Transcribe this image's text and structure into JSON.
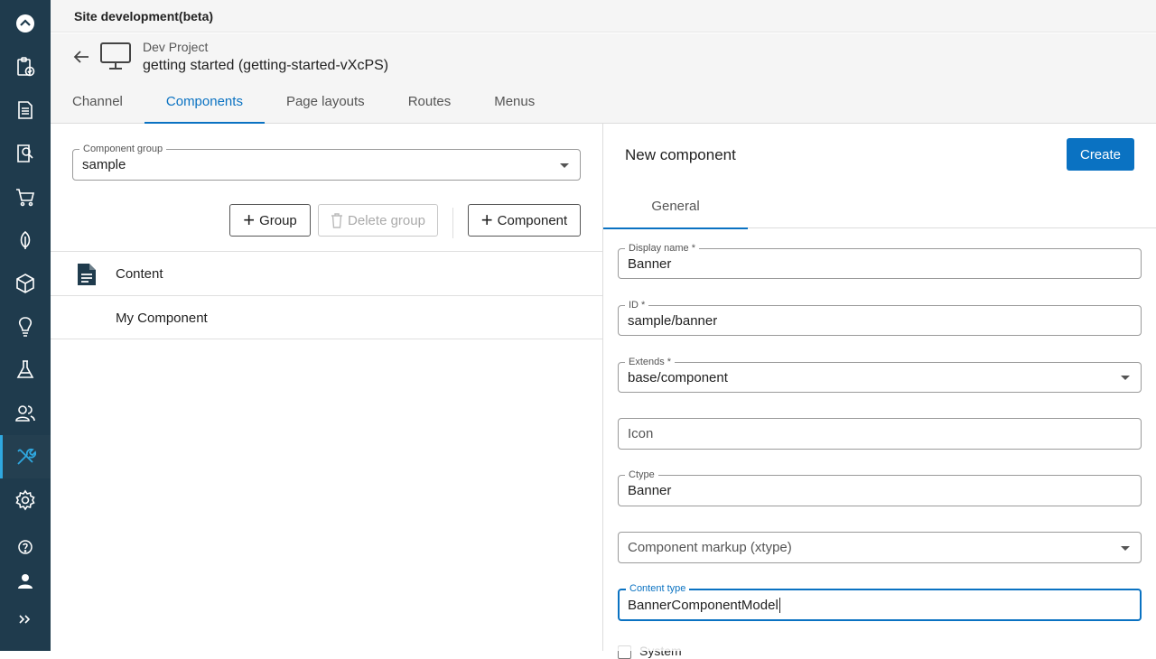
{
  "app": {
    "title": "Site development(beta)"
  },
  "nav": {
    "items": [
      {
        "icon": "collapse-up-icon"
      },
      {
        "icon": "clipboard-check-icon"
      },
      {
        "icon": "document-icon"
      },
      {
        "icon": "search-document-icon"
      },
      {
        "icon": "cart-icon"
      },
      {
        "icon": "leaf-icon"
      },
      {
        "icon": "cube-icon"
      },
      {
        "icon": "lightbulb-icon"
      },
      {
        "icon": "flask-icon"
      },
      {
        "icon": "users-icon"
      },
      {
        "icon": "tools-icon",
        "active": true
      },
      {
        "icon": "gear-icon"
      },
      {
        "icon": "help-icon"
      },
      {
        "icon": "user-icon"
      },
      {
        "icon": "expand-icon"
      }
    ]
  },
  "header": {
    "project": "Dev Project",
    "site": "getting started (getting-started-vXcPS)",
    "tabs": [
      "Channel",
      "Components",
      "Page layouts",
      "Routes",
      "Menus"
    ],
    "active_tab": "Components"
  },
  "left": {
    "group_label": "Component group",
    "group_value": "sample",
    "buttons": {
      "group": "Group",
      "delete_group": "Delete group",
      "component": "Component"
    },
    "rows": [
      {
        "label": "Content",
        "icon": "document-icon"
      },
      {
        "label": "My Component"
      }
    ]
  },
  "right": {
    "title": "New component",
    "create": "Create",
    "subtab": "General",
    "fields": {
      "display_name": {
        "label": "Display name *",
        "value": "Banner"
      },
      "id": {
        "label": "ID *",
        "value": "sample/banner"
      },
      "extends": {
        "label": "Extends *",
        "value": "base/component"
      },
      "icon": {
        "placeholder": "Icon"
      },
      "ctype": {
        "label": "Ctype",
        "value": "Banner"
      },
      "markup": {
        "placeholder": "Component markup (xtype)"
      },
      "content_type": {
        "label": "Content type",
        "value": "BannerComponentModel"
      }
    },
    "system_label": "System"
  },
  "colors": {
    "nav_bg": "#1f3b4d",
    "accent": "#0a72c2",
    "active_marker": "#2fa8e0"
  }
}
